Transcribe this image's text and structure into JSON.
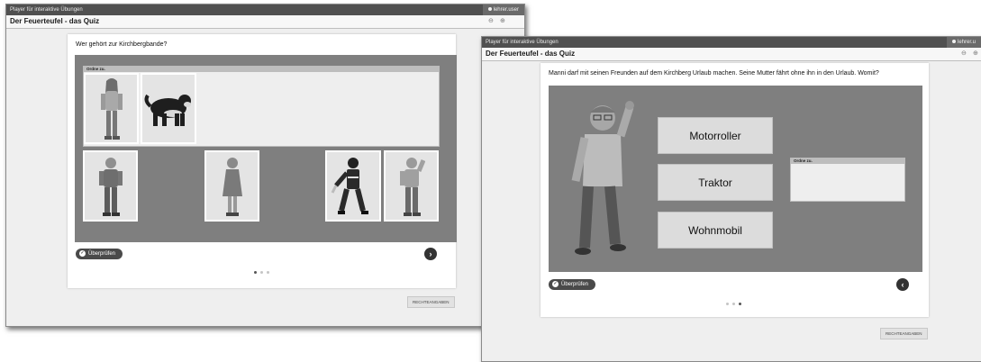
{
  "left_window": {
    "titlebar": "Player für interaktive Übungen",
    "user": "lehrer.user",
    "app_title": "Der Feuerteufel - das Quiz",
    "zoom_out": "⊖",
    "zoom_in": "⊕",
    "question": "Wer gehört zur Kirchbergbande?",
    "dropzone_label": "Ordne zu.",
    "check_button": "Überprüfen",
    "next_icon": "›",
    "credits_button": "RECHTEANGABEN",
    "page_count": 3,
    "active_page": 1
  },
  "right_window": {
    "titlebar": "Player für interaktive Übungen",
    "user": "lehrer.u",
    "app_title": "Der Feuerteufel - das Quiz",
    "zoom_out": "⊖",
    "zoom_in": "⊕",
    "question": "Manni darf mit seinen Freunden auf dem Kirchberg Urlaub machen. Seine Mutter fährt ohne ihn in den Urlaub. Womit?",
    "answers": [
      "Motorroller",
      "Traktor",
      "Wohnmobil"
    ],
    "dropzone_label": "Ordne zu.",
    "check_button": "Überprüfen",
    "prev_icon": "‹",
    "credits_button": "RECHTEANGABEN",
    "page_count": 3,
    "active_page": 3
  }
}
